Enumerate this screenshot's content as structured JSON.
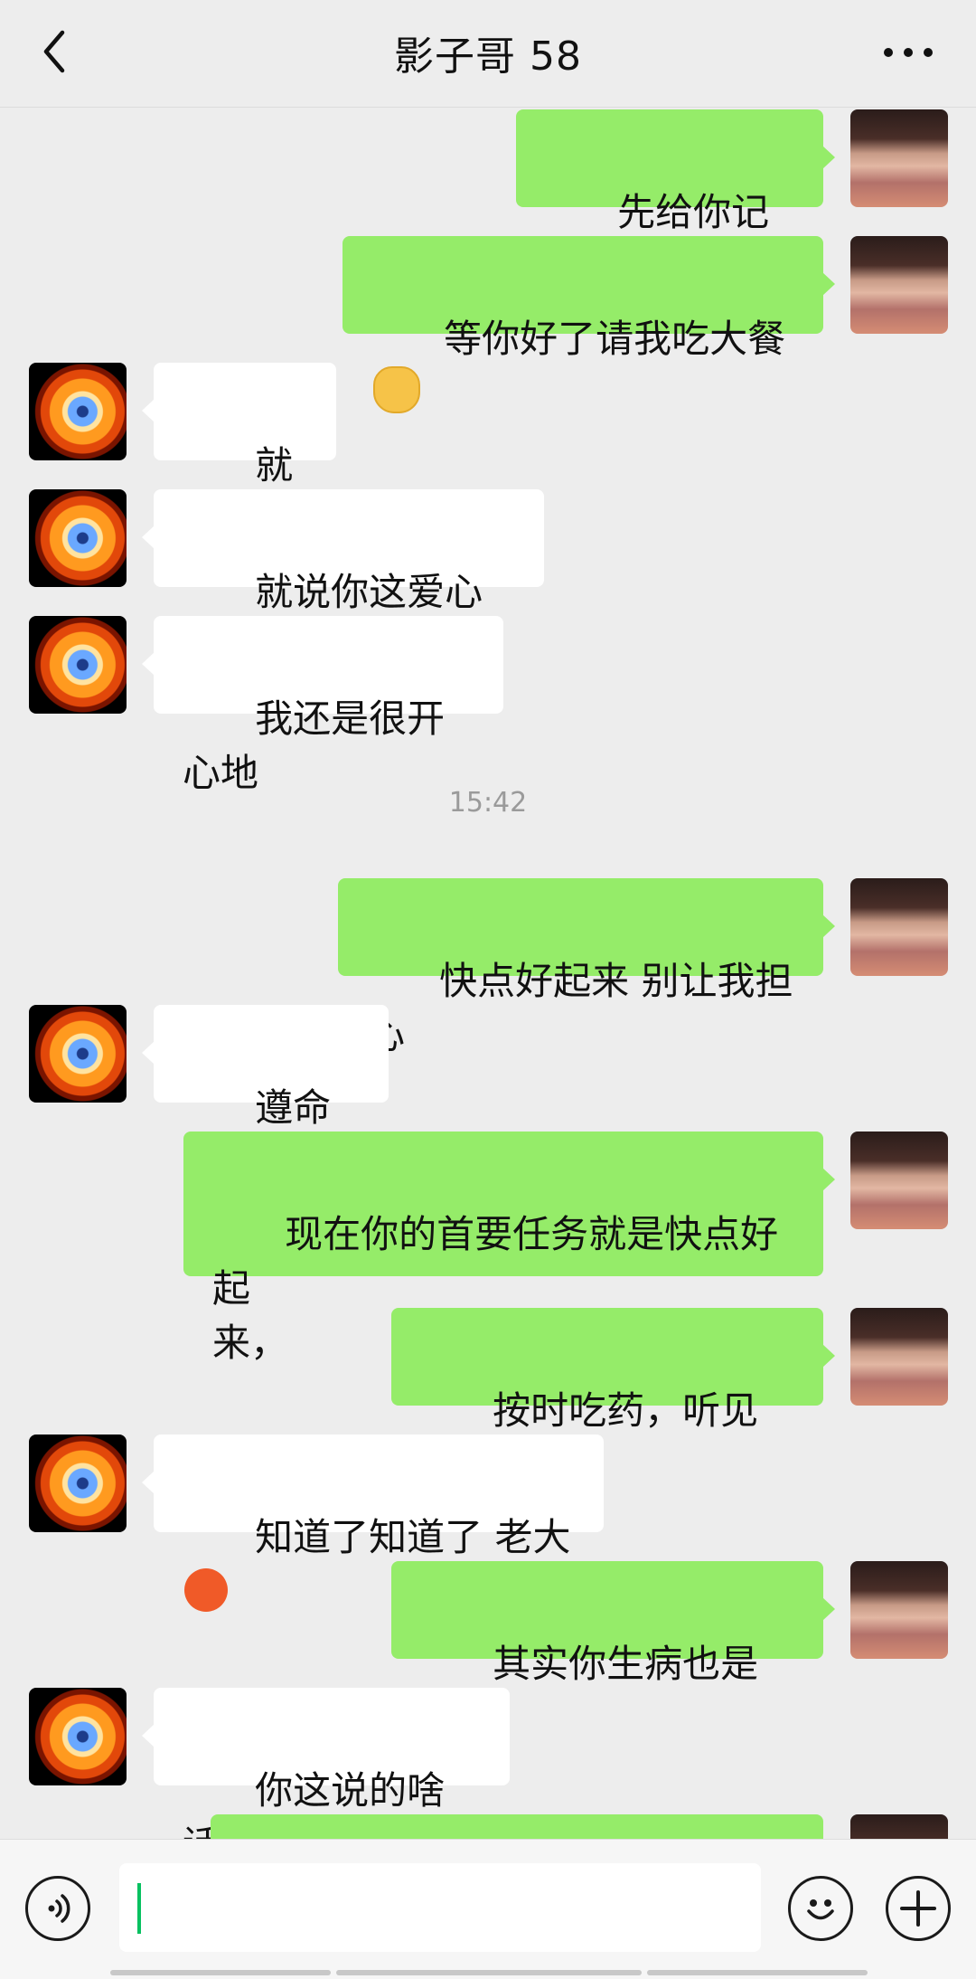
{
  "header": {
    "title": "影子哥 58",
    "back_icon": "chevron-left-icon",
    "more_icon": "more-dots-icon"
  },
  "messages": [
    {
      "side": "right",
      "text": "先给你记账上"
    },
    {
      "side": "right",
      "text": "等你好了请我吃大餐",
      "emoji": "cat-emoji"
    },
    {
      "side": "left",
      "text": "就这啊"
    },
    {
      "side": "left",
      "text": "就说你这爱心便当"
    },
    {
      "side": "left",
      "text": "我还是很开心地"
    },
    {
      "time": "15:42"
    },
    {
      "side": "right",
      "text": "快点好起来 别让我担心"
    },
    {
      "side": "left",
      "text": "遵命 老大"
    },
    {
      "side": "right",
      "text": "现在你的首要任务就是快点好起\n来，"
    },
    {
      "side": "right",
      "text": "按时吃药，听见了没"
    },
    {
      "side": "left",
      "text": "知道了知道了 老大",
      "emoji": "sweat-emoji"
    },
    {
      "side": "right",
      "text": "其实你生病也是好事"
    },
    {
      "side": "left",
      "text": "你这说的啥话",
      "emoji": "crying-emoji"
    }
  ],
  "input_bar": {
    "voice_icon": "voice-icon",
    "emoji_icon": "emoji-icon",
    "plus_icon": "plus-icon",
    "input_value": ""
  },
  "colors": {
    "background": "#ededed",
    "sent_bubble": "#95ec69",
    "received_bubble": "#ffffff",
    "caret": "#07c160"
  }
}
